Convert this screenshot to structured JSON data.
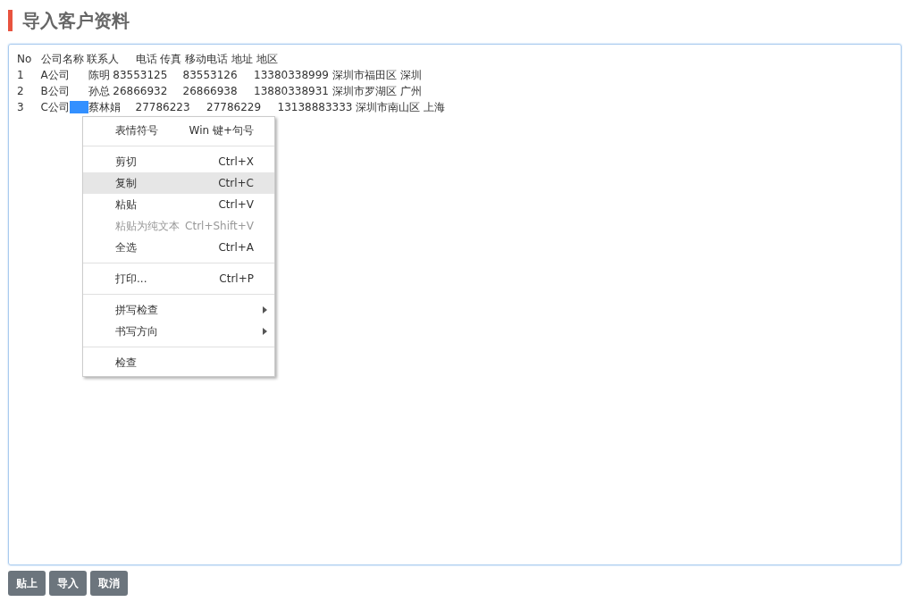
{
  "title": "导入客户资料",
  "editor": {
    "lines": [
      {
        "text": "No\t公司名称 联系人\t电话 传真 移动电话 地址 地区"
      },
      {
        "text": "1\tA公司\t陈明 83553125\t83553126\t13380338999 深圳市福田区 深圳"
      },
      {
        "text": "2\tB公司\t孙总 26866932\t26866938\t13880338931 深圳市罗湖区 广州"
      },
      {
        "text": "3\tC公司",
        "tab_selected": true,
        "text_after": "蔡林娟\t27786223\t27786229\t13138883333 深圳市南山区 上海"
      }
    ]
  },
  "context_menu": [
    {
      "kind": "item",
      "label": "表情符号",
      "shortcut": "Win 键+句号",
      "selected": false,
      "disabled": false
    },
    {
      "kind": "separator"
    },
    {
      "kind": "item",
      "label": "剪切",
      "shortcut": "Ctrl+X",
      "selected": false,
      "disabled": false
    },
    {
      "kind": "item",
      "label": "复制",
      "shortcut": "Ctrl+C",
      "selected": true,
      "disabled": false
    },
    {
      "kind": "item",
      "label": "粘贴",
      "shortcut": "Ctrl+V",
      "selected": false,
      "disabled": false
    },
    {
      "kind": "item",
      "label": "粘贴为纯文本",
      "shortcut": "Ctrl+Shift+V",
      "selected": false,
      "disabled": true
    },
    {
      "kind": "item",
      "label": "全选",
      "shortcut": "Ctrl+A",
      "selected": false,
      "disabled": false
    },
    {
      "kind": "separator"
    },
    {
      "kind": "item",
      "label": "打印...",
      "shortcut": "Ctrl+P",
      "selected": false,
      "disabled": false
    },
    {
      "kind": "separator"
    },
    {
      "kind": "submenu",
      "label": "拼写检查",
      "selected": false,
      "disabled": false
    },
    {
      "kind": "submenu",
      "label": "书写方向",
      "selected": false,
      "disabled": false
    },
    {
      "kind": "separator"
    },
    {
      "kind": "item",
      "label": "检查",
      "selected": false,
      "disabled": false
    }
  ],
  "buttons": [
    "贴上",
    "导入",
    "取消"
  ]
}
